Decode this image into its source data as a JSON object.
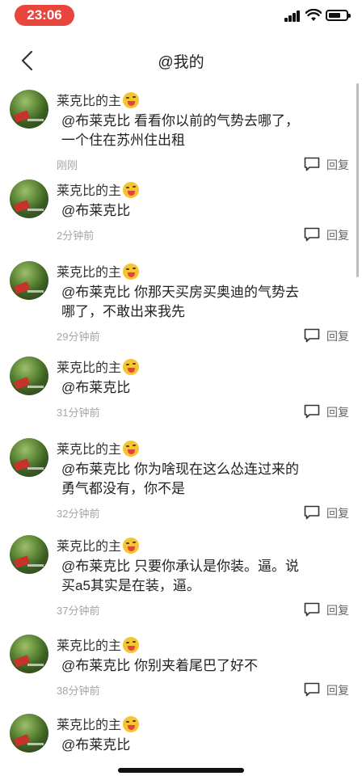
{
  "status": {
    "time": "23:06"
  },
  "nav": {
    "title": "@我的"
  },
  "reply_label": "回复",
  "comments": [
    {
      "user": "莱克比的主",
      "lines": [
        "@布莱克比 看看你以前的气势去哪了，",
        "一个住在苏州住出租"
      ],
      "time": "刚刚"
    },
    {
      "user": "莱克比的主",
      "lines": [
        "@布莱克比"
      ],
      "time": "2分钟前"
    },
    {
      "user": "莱克比的主",
      "lines": [
        "@布莱克比 你那天买房买奥迪的气势去",
        "哪了，不敢出来我先"
      ],
      "time": "29分钟前"
    },
    {
      "user": "莱克比的主",
      "lines": [
        "@布莱克比"
      ],
      "time": "31分钟前"
    },
    {
      "user": "莱克比的主",
      "lines": [
        "@布莱克比 你为啥现在这么怂连过来的",
        "勇气都没有，你不是"
      ],
      "time": "32分钟前"
    },
    {
      "user": "莱克比的主",
      "lines": [
        "@布莱克比 只要你承认是你装。逼。说",
        "买a5其实是在装，逼。"
      ],
      "time": "37分钟前"
    },
    {
      "user": "莱克比的主",
      "lines": [
        "@布莱克比 你别夹着尾巴了好不"
      ],
      "time": "38分钟前"
    },
    {
      "user": "莱克比的主",
      "lines": [
        "@布莱克比"
      ],
      "time": ""
    }
  ]
}
